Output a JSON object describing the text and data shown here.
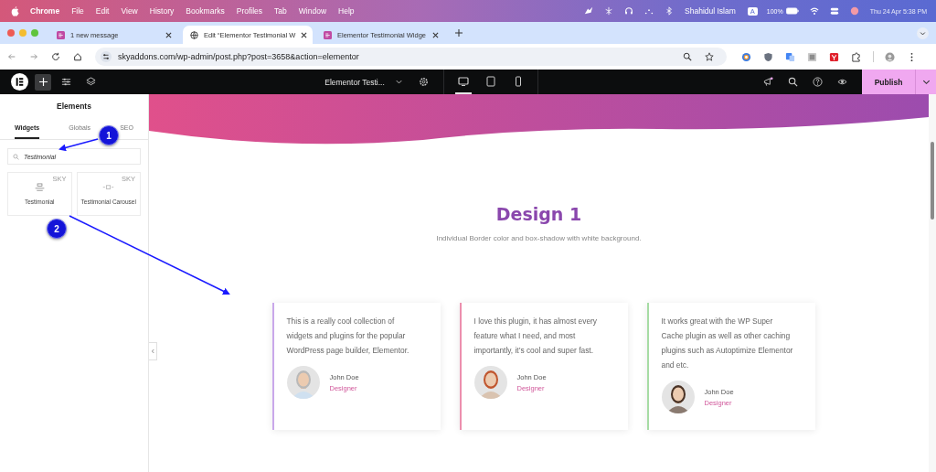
{
  "menubar": {
    "app": "Chrome",
    "menus": [
      "File",
      "Edit",
      "View",
      "History",
      "Bookmarks",
      "Profiles",
      "Tab",
      "Window",
      "Help"
    ],
    "user": "Shahidul Islam",
    "input_source": "A",
    "battery": "100%",
    "clock": "Thu 24 Apr  5:38 PM"
  },
  "tabs": [
    {
      "title": "1 new message",
      "selected": false
    },
    {
      "title": "Edit “Elementor Testimonial W",
      "selected": true
    },
    {
      "title": "Elementor Testimonial Widge",
      "selected": false
    }
  ],
  "address": "skyaddons.com/wp-admin/post.php?post=3658&action=elementor",
  "editor": {
    "document": "Elementor Testi...",
    "publish": "Publish",
    "devices": [
      {
        "kind": "desktop",
        "selected": true
      },
      {
        "kind": "tablet",
        "selected": false
      },
      {
        "kind": "mobile",
        "selected": false
      }
    ]
  },
  "panel": {
    "title": "Elements",
    "tabs": [
      {
        "label": "Widgets",
        "selected": true
      },
      {
        "label": "Globals",
        "selected": false
      },
      {
        "label": "SEO",
        "selected": false
      }
    ],
    "search": {
      "value": "Testimonial"
    },
    "widgets": [
      {
        "label": "Testimonial",
        "badge": "SKY"
      },
      {
        "label": "Testimonial Carousel",
        "badge": "SKY"
      }
    ]
  },
  "section": {
    "heading": "Design 1",
    "subheading": "Individual Border color and box-shadow with white background.",
    "cards": [
      {
        "quote": "This is a really cool collection of widgets and plugins for the popular WordPress page builder, Elementor.",
        "name": "John Doe",
        "role": "Designer",
        "color": "#c9a8ea"
      },
      {
        "quote": "I love this plugin, it has almost every feature what I need, and most importantly, it’s cool and super fast.",
        "name": "John Doe",
        "role": "Designer",
        "color": "#ec8fae"
      },
      {
        "quote": "It works great with the WP Super Cache plugin as well as other caching plugins such as Autoptimize Elementor and etc.",
        "name": "John Doe",
        "role": "Designer",
        "color": "#a6dca4"
      }
    ]
  },
  "annotations": [
    {
      "number": "1"
    },
    {
      "number": "2"
    }
  ]
}
